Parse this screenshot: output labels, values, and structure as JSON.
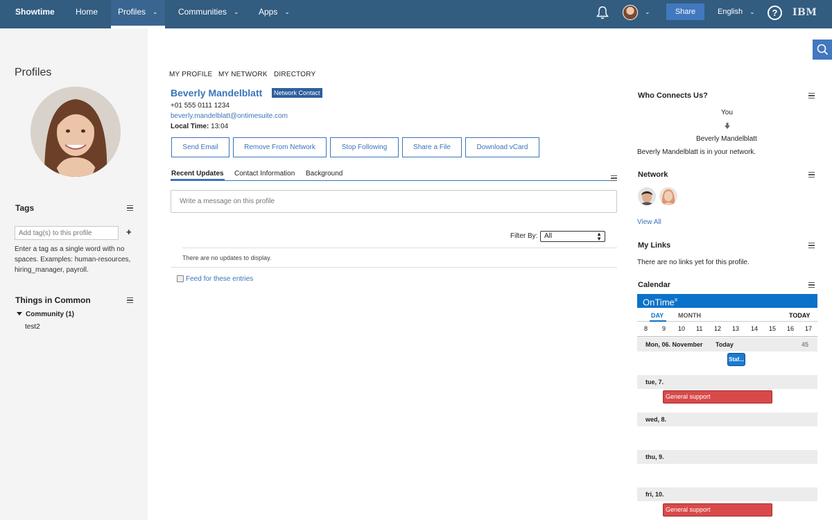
{
  "topbar": {
    "brand": "Showtime",
    "nav": [
      {
        "label": "Home",
        "has_menu": false
      },
      {
        "label": "Profiles",
        "has_menu": true,
        "active": true
      },
      {
        "label": "Communities",
        "has_menu": true
      },
      {
        "label": "Apps",
        "has_menu": true
      }
    ],
    "share_label": "Share",
    "language": "English",
    "help_glyph": "?",
    "logo_text": "IBM",
    "icons": [
      "bell-icon",
      "chevron-down-icon",
      "help-icon",
      "search-icon"
    ]
  },
  "sidebar": {
    "title": "Profiles",
    "tags": {
      "heading": "Tags",
      "placeholder": "Add tag(s) to this profile",
      "add_glyph": "+",
      "help": "Enter a tag as a single word with no spaces. Examples: human-resources, hiring_manager, payroll."
    },
    "common": {
      "heading": "Things in Common",
      "node": "Community (1)",
      "leaf": "test2"
    }
  },
  "main": {
    "subnav": [
      "MY PROFILE",
      "MY NETWORK",
      "DIRECTORY"
    ],
    "name": "Beverly Mandelblatt",
    "badge": "Network Contact",
    "phone": "+01 555 0111 1234",
    "email": "beverly.mandelblatt@ontimesuite.com",
    "local_time_label": "Local Time:",
    "local_time": "13:04",
    "actions": [
      "Send Email",
      "Remove From Network",
      "Stop Following",
      "Share a File",
      "Download vCard"
    ],
    "tabs": [
      "Recent Updates",
      "Contact Information",
      "Background"
    ],
    "message_placeholder": "Write a message on this profile",
    "filter_label": "Filter By:",
    "filter_value": "All",
    "no_updates": "There are no updates to display.",
    "feed_link": "Feed for these entries"
  },
  "right": {
    "connects": {
      "title": "Who Connects Us?",
      "from": "You",
      "to": "Beverly Mandelblatt",
      "summary": "Beverly Mandelblatt is in your network."
    },
    "network": {
      "title": "Network",
      "view_all": "View All"
    },
    "links": {
      "title": "My Links",
      "empty": "There are no links yet for this profile."
    },
    "calendar": {
      "title": "Calendar",
      "brand": "OnTime",
      "brand_mark": "®",
      "tabs": [
        "DAY",
        "MONTH"
      ],
      "today": "TODAY",
      "hours": [
        "8",
        "9",
        "10",
        "11",
        "12",
        "13",
        "14",
        "15",
        "16",
        "17"
      ],
      "days": [
        {
          "label": "Mon, 06. November",
          "tag": "Today",
          "extra": "45"
        },
        {
          "label": "tue, 7."
        },
        {
          "label": "wed, 8."
        },
        {
          "label": "thu, 9."
        },
        {
          "label": "fri, 10."
        }
      ],
      "events": [
        {
          "label": "Staf...",
          "color": "#1d7bd2"
        },
        {
          "label": "General support",
          "color": "#d84a4a"
        },
        {
          "label": "General support",
          "color": "#d84a4a"
        }
      ]
    }
  },
  "colors": {
    "topbar": "#325c80",
    "accent": "#3b73b9",
    "calendar": "#0b72c9"
  }
}
